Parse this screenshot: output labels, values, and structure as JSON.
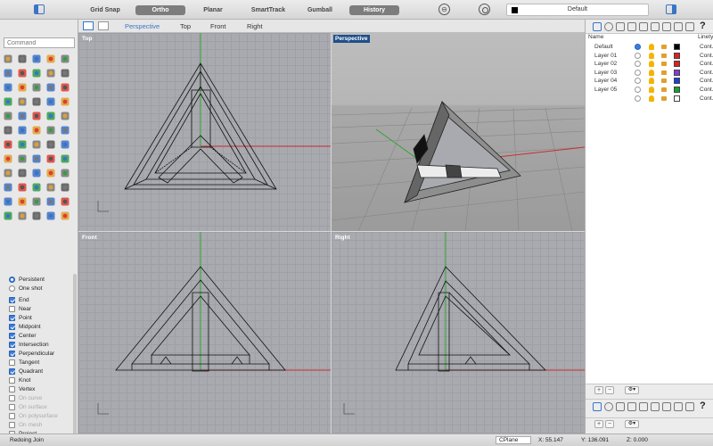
{
  "toolbar": {
    "toggles": [
      {
        "label": "Grid Snap",
        "on": false
      },
      {
        "label": "Ortho",
        "on": true
      },
      {
        "label": "Planar",
        "on": false
      },
      {
        "label": "SmartTrack",
        "on": false
      },
      {
        "label": "Gumball",
        "on": false
      },
      {
        "label": "History",
        "on": true
      }
    ],
    "current_layer": "Default",
    "current_layer_color": "#000000"
  },
  "command": {
    "placeholder": "Command"
  },
  "viewport_tabs": [
    "Perspective",
    "Top",
    "Front",
    "Right"
  ],
  "active_viewport_tab": "Perspective",
  "viewports": {
    "top": {
      "label": "Top"
    },
    "perspective": {
      "label": "Perspective"
    },
    "front": {
      "label": "Front"
    },
    "right": {
      "label": "Right"
    }
  },
  "osnap": {
    "modes": [
      {
        "label": "Persistent",
        "kind": "radio",
        "checked": true
      },
      {
        "label": "One shot",
        "kind": "radio",
        "checked": false
      }
    ],
    "items": [
      {
        "label": "End",
        "checked": true,
        "enabled": true
      },
      {
        "label": "Near",
        "checked": false,
        "enabled": true
      },
      {
        "label": "Point",
        "checked": true,
        "enabled": true
      },
      {
        "label": "Midpoint",
        "checked": true,
        "enabled": true
      },
      {
        "label": "Center",
        "checked": true,
        "enabled": true
      },
      {
        "label": "Intersection",
        "checked": true,
        "enabled": true
      },
      {
        "label": "Perpendicular",
        "checked": true,
        "enabled": true
      },
      {
        "label": "Tangent",
        "checked": false,
        "enabled": true
      },
      {
        "label": "Quadrant",
        "checked": true,
        "enabled": true
      },
      {
        "label": "Knot",
        "checked": false,
        "enabled": true
      },
      {
        "label": "Vertex",
        "checked": false,
        "enabled": true
      },
      {
        "label": "On curve",
        "checked": false,
        "enabled": false
      },
      {
        "label": "On surface",
        "checked": false,
        "enabled": false
      },
      {
        "label": "On polysurface",
        "checked": false,
        "enabled": false
      },
      {
        "label": "On mesh",
        "checked": false,
        "enabled": false
      },
      {
        "label": "Project",
        "checked": false,
        "enabled": true
      }
    ]
  },
  "layers": {
    "headers": {
      "name": "Name",
      "linetype": "Linety"
    },
    "rows": [
      {
        "name": "Default",
        "current": true,
        "color": "#000000",
        "linetype": "Cont."
      },
      {
        "name": "Layer 01",
        "current": false,
        "color": "#e02020",
        "linetype": "Cont."
      },
      {
        "name": "Layer 02",
        "current": false,
        "color": "#e02020",
        "linetype": "Cont."
      },
      {
        "name": "Layer 03",
        "current": false,
        "color": "#8a3ad6",
        "linetype": "Cont."
      },
      {
        "name": "Layer 04",
        "current": false,
        "color": "#1a3ee0",
        "linetype": "Cont."
      },
      {
        "name": "Layer 05",
        "current": false,
        "color": "#1aa033",
        "linetype": "Cont."
      },
      {
        "name": "",
        "current": false,
        "color": "#ffffff",
        "linetype": "Cont."
      }
    ]
  },
  "statusbar": {
    "message": "Redoing Join",
    "cplane": "CPlane",
    "x": "X: 55.147",
    "y": "Y: 136.091",
    "z": "Z: 0.000"
  },
  "help_glyph": "?"
}
